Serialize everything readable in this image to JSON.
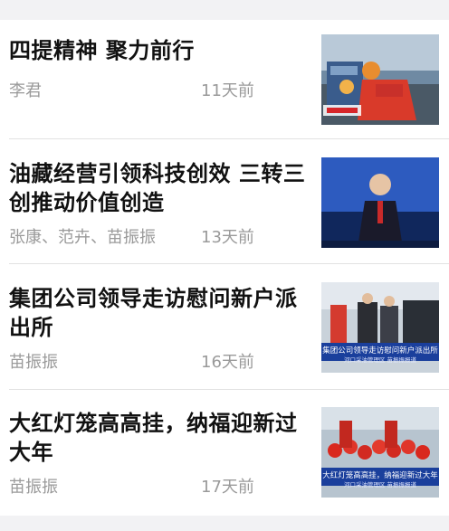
{
  "articles": [
    {
      "title": "四提精神 聚力前行",
      "author": "李君",
      "time": "11天前",
      "image_icon": "worker-welding-photo"
    },
    {
      "title": "油藏经营引领科技创效 三转三创推动价值创造",
      "author": "张康、范卉、苗振振",
      "time": "13天前",
      "image_icon": "news-anchor-photo"
    },
    {
      "title": "集团公司领导走访慰问新户派出所",
      "author": "苗振振",
      "time": "16天前",
      "image_caption": "集团公司领导走访慰问新户派出所",
      "image_subcaption": "河口采油管理区 苗振振报道"
    },
    {
      "title": "大红灯笼高高挂，纳福迎新过大年",
      "author": "苗振振",
      "time": "17天前",
      "image_caption": "大红灯笼高高挂，纳福迎新过大年",
      "image_subcaption": "河口采油管理区 苗振振报道"
    }
  ]
}
